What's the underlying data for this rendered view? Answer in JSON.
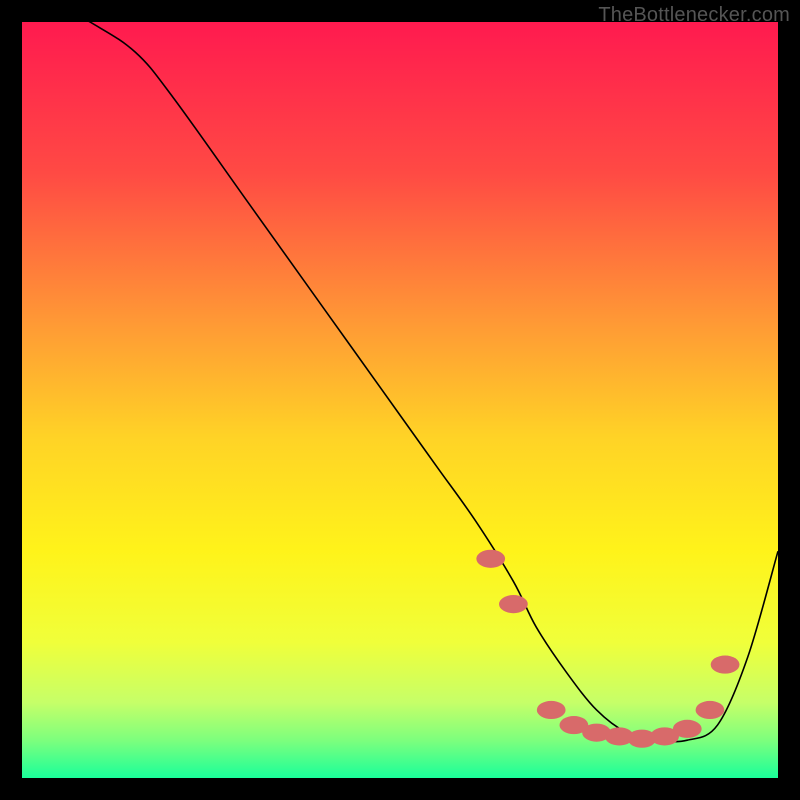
{
  "watermark": "TheBottlenecker.com",
  "chart_data": {
    "type": "line",
    "title": "",
    "xlabel": "",
    "ylabel": "",
    "xlim": [
      0,
      100
    ],
    "ylim": [
      0,
      100
    ],
    "grid": false,
    "background": {
      "type": "vertical-gradient",
      "stops": [
        {
          "offset": 0.0,
          "color": "#ff1a4f"
        },
        {
          "offset": 0.2,
          "color": "#ff4a44"
        },
        {
          "offset": 0.4,
          "color": "#ff9a35"
        },
        {
          "offset": 0.55,
          "color": "#ffd326"
        },
        {
          "offset": 0.7,
          "color": "#fff31a"
        },
        {
          "offset": 0.82,
          "color": "#f0ff3a"
        },
        {
          "offset": 0.9,
          "color": "#c6ff68"
        },
        {
          "offset": 0.95,
          "color": "#7dff7d"
        },
        {
          "offset": 1.0,
          "color": "#1aff9a"
        }
      ]
    },
    "series": [
      {
        "name": "curve",
        "color": "#000000",
        "width": 1.6,
        "x": [
          0,
          9,
          15,
          20,
          30,
          40,
          50,
          55,
          60,
          65,
          68,
          72,
          76,
          80,
          84,
          88,
          92,
          96,
          100
        ],
        "y": [
          105,
          100,
          96,
          90,
          76,
          62,
          48,
          41,
          34,
          26,
          20,
          14,
          9,
          6,
          5,
          5,
          7,
          16,
          30
        ]
      }
    ],
    "markers": {
      "color": "#d86a6a",
      "ellipse_rx": 1.9,
      "ellipse_ry": 1.2,
      "points": [
        {
          "x": 62,
          "y": 29
        },
        {
          "x": 65,
          "y": 23
        },
        {
          "x": 70,
          "y": 9
        },
        {
          "x": 73,
          "y": 7
        },
        {
          "x": 76,
          "y": 6
        },
        {
          "x": 79,
          "y": 5.5
        },
        {
          "x": 82,
          "y": 5.2
        },
        {
          "x": 85,
          "y": 5.5
        },
        {
          "x": 88,
          "y": 6.5
        },
        {
          "x": 91,
          "y": 9
        },
        {
          "x": 93,
          "y": 15
        }
      ]
    }
  }
}
